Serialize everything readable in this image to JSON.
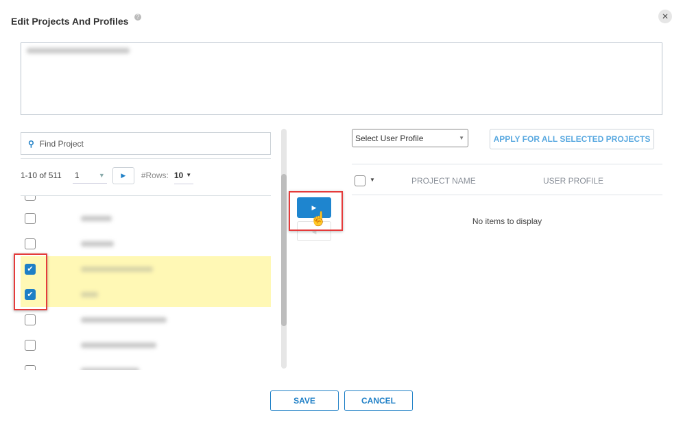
{
  "dialog": {
    "title": "Edit Projects And Profiles",
    "help_icon": "?",
    "close_icon": "✕"
  },
  "left": {
    "search_placeholder": "Find Project",
    "range": "1-10 of 511",
    "page": "1",
    "rows_label": "#Rows:",
    "rows_value": "10",
    "items": [
      {
        "checked": false,
        "selected": false
      },
      {
        "checked": false,
        "selected": false
      },
      {
        "checked": false,
        "selected": false
      },
      {
        "checked": true,
        "selected": true
      },
      {
        "checked": true,
        "selected": true
      },
      {
        "checked": false,
        "selected": false
      },
      {
        "checked": false,
        "selected": false
      },
      {
        "checked": false,
        "selected": false
      }
    ]
  },
  "right": {
    "profile_placeholder": "Select User Profile",
    "apply_label": "APPLY FOR ALL SELECTED PROJECTS",
    "columns": [
      "PROJECT NAME",
      "USER PROFILE"
    ],
    "empty": "No items to display"
  },
  "footer": {
    "save": "SAVE",
    "cancel": "CANCEL"
  },
  "colors": {
    "accent": "#1e85cf",
    "highlight": "#fff8b5",
    "annotation": "#e53b3b"
  }
}
